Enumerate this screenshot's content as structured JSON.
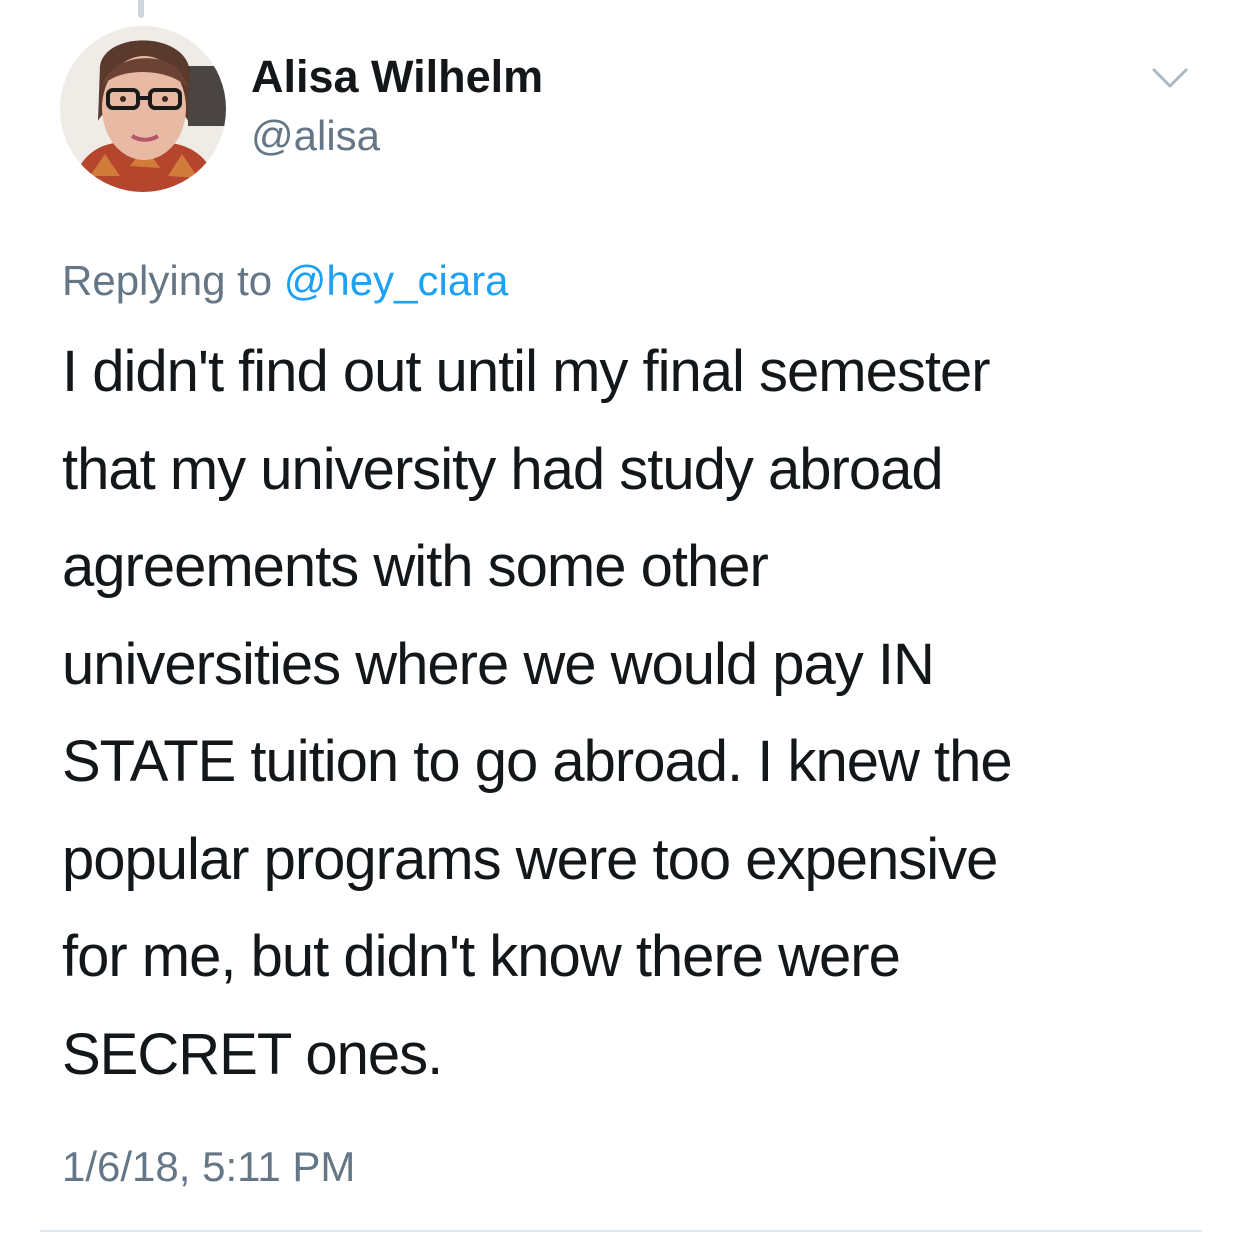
{
  "author": {
    "display_name": "Alisa Wilhelm",
    "handle": "@alisa"
  },
  "reply": {
    "prefix": "Replying to ",
    "mention": "@hey_ciara"
  },
  "tweet": {
    "lines": [
      "I didn't find out until my final semester",
      "that my university had study abroad",
      "agreements with some other",
      "universities where we would pay IN",
      "STATE tuition to go abroad. I knew the",
      "popular programs were too expensive",
      "for me, but didn't know there were",
      "SECRET ones."
    ],
    "timestamp": "1/6/18, 5:11 PM"
  },
  "icons": {
    "menu": "chevron-down-icon",
    "avatar": "profile-photo"
  },
  "colors": {
    "text": "#14171a",
    "secondary": "#657786",
    "link": "#1da1f2",
    "divider": "#e1e8ed"
  }
}
